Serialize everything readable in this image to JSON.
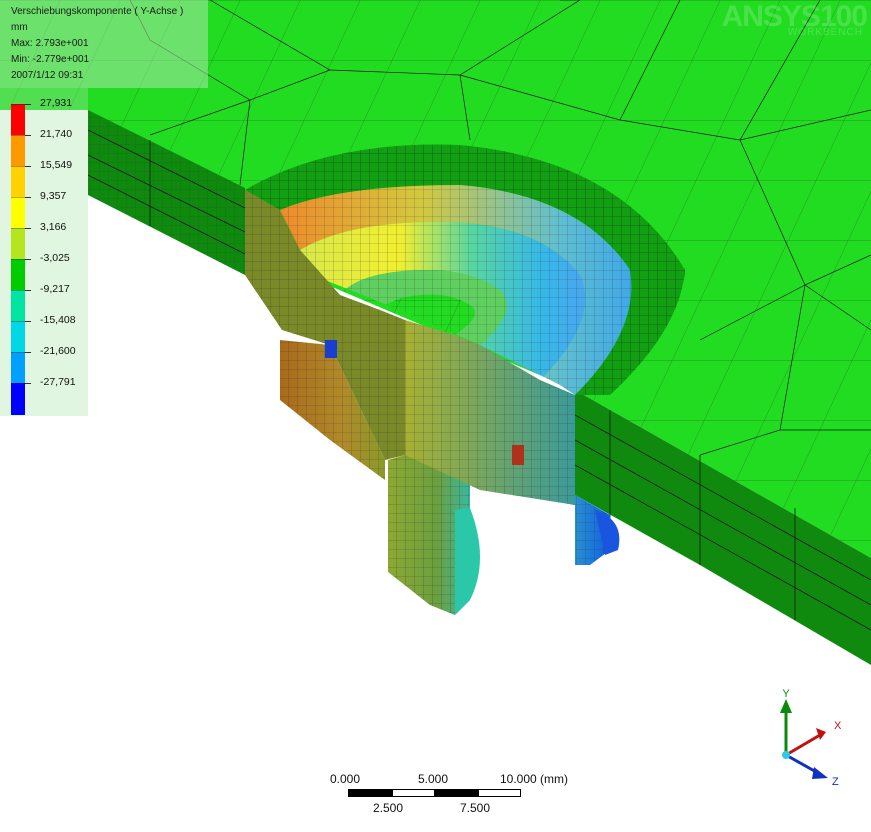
{
  "legend": {
    "title": "Verschiebungskomponente ( Y-Achse )",
    "unit": "mm",
    "max": "Max: 2.793e+001",
    "min": "Min: -2.779e+001",
    "timestamp": "2007/1/12 09:31",
    "levels": [
      "27,931",
      "21,740",
      "15,549",
      "9,357",
      "3,166",
      "-3,025",
      "-9,217",
      "-15,408",
      "-21,600",
      "-27,791"
    ],
    "colors": [
      "#ff0000",
      "#ff9900",
      "#ffd200",
      "#ffff00",
      "#b5e61d",
      "#00cc00",
      "#00e6a0",
      "#00d8e6",
      "#00a0ff",
      "#0000ff"
    ]
  },
  "watermark": {
    "logo": "ANSYS100",
    "sub": "WORKBENCH"
  },
  "scale": {
    "top_labels": [
      "0.000",
      "5.000",
      "10.000 (mm)"
    ],
    "bottom_labels": [
      "2.500",
      "7.500"
    ]
  },
  "triad": {
    "x": "X",
    "y": "Y",
    "z": "Z"
  }
}
